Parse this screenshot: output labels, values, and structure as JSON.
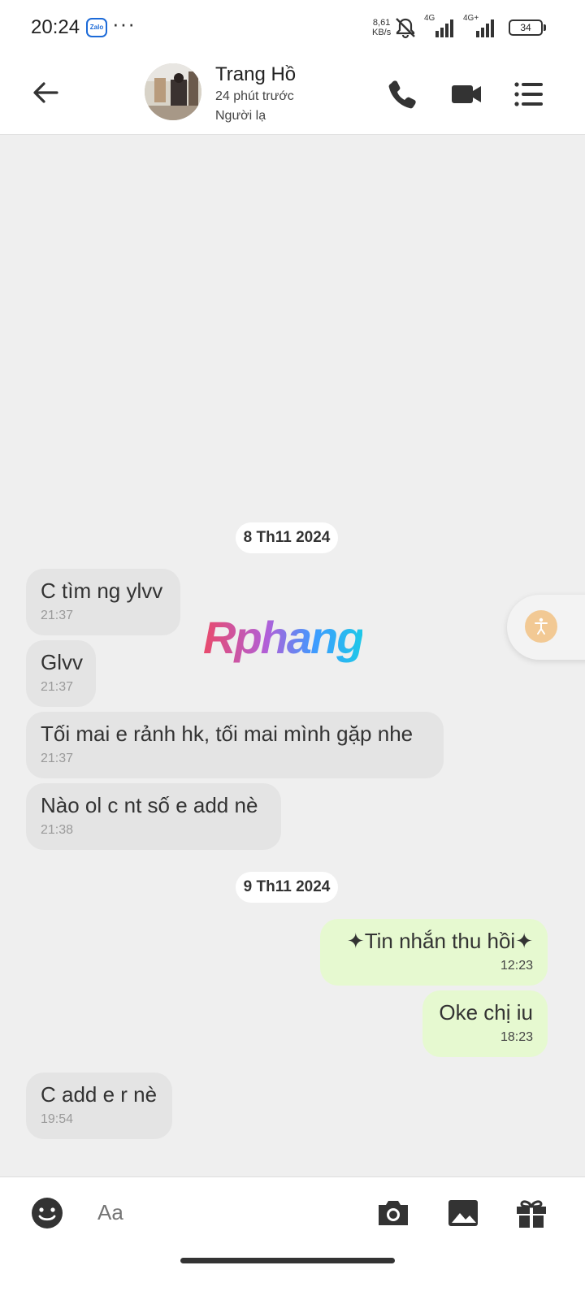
{
  "status_bar": {
    "time": "20:24",
    "app_badge": "Zalo",
    "more": "···",
    "net_speed_value": "8,61",
    "net_speed_unit": "KB/s",
    "sim1": "4G",
    "sim2": "4G+",
    "battery": "34"
  },
  "header": {
    "name": "Trang Hồ",
    "last_seen": "24 phút trước",
    "relation": "Người lạ"
  },
  "conversation": {
    "date1": "8 Th11 2024",
    "date2": "9 Th11 2024",
    "messages": [
      {
        "dir": "in",
        "text": "C tìm ng ylvv",
        "time": "21:37"
      },
      {
        "dir": "in",
        "text": "Glvv",
        "time": "21:37"
      },
      {
        "dir": "in",
        "text": "Tối mai e rảnh hk, tối mai mình gặp nhe",
        "time": "21:37"
      },
      {
        "dir": "in",
        "text": "Nào ol c nt số e add nè",
        "time": "21:38"
      },
      {
        "dir": "out",
        "text": "✦Tin nhắn thu hồi✦",
        "time": "12:23"
      },
      {
        "dir": "out",
        "text": "Oke chị iu",
        "time": "18:23"
      },
      {
        "dir": "in",
        "text": "C add e r nè",
        "time": "19:54"
      }
    ]
  },
  "watermark": "Rphang",
  "input": {
    "placeholder": "Aa"
  },
  "colors": {
    "incoming_bubble": "#e4e4e4",
    "outgoing_bubble": "#e6f9d0",
    "background": "#efefef"
  }
}
